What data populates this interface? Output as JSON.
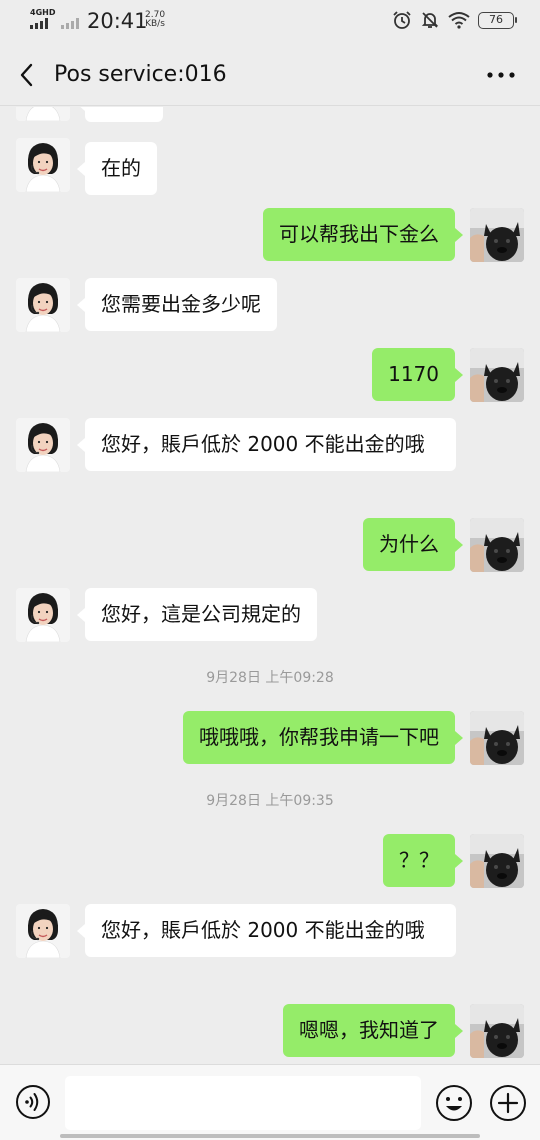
{
  "status_bar": {
    "network": "4GHD",
    "time": "20:41",
    "speed_value": "2.70",
    "speed_unit": "KB/s",
    "battery": "76",
    "icons": [
      "alarm-icon",
      "mute-icon",
      "wifi-icon",
      "battery-icon"
    ]
  },
  "header": {
    "back_icon": "chevron-left-icon",
    "title": "Pos service:016",
    "more_icon": "more-horizontal-icon"
  },
  "messages": [
    {
      "side": "in",
      "text": "在的"
    },
    {
      "side": "out",
      "text": "可以帮我出下金么"
    },
    {
      "side": "in",
      "text": "您需要出金多少呢"
    },
    {
      "side": "out",
      "text": "1170"
    },
    {
      "side": "in",
      "text": "您好，賬戶低於 2000 不能出金的哦"
    },
    {
      "side": "out",
      "text": "为什么"
    },
    {
      "side": "in",
      "text": "您好，這是公司規定的"
    },
    {
      "type": "time",
      "text": "9月28日 上午09:28"
    },
    {
      "side": "out",
      "text": "哦哦哦，你帮我申请一下吧"
    },
    {
      "type": "time",
      "text": "9月28日 上午09:35"
    },
    {
      "side": "out",
      "text": "？？"
    },
    {
      "side": "in",
      "text": "您好，賬戶低於 2000 不能出金的哦"
    },
    {
      "side": "out",
      "text": "嗯嗯，我知道了"
    }
  ],
  "input_bar": {
    "voice_icon": "voice-icon",
    "input_value": "",
    "emoji_icon": "emoji-icon",
    "plus_icon": "plus-icon"
  },
  "colors": {
    "background": "#ededed",
    "outgoing_bubble": "#95ec69",
    "incoming_bubble": "#ffffff",
    "timestamp_text": "#9a9a9a"
  }
}
